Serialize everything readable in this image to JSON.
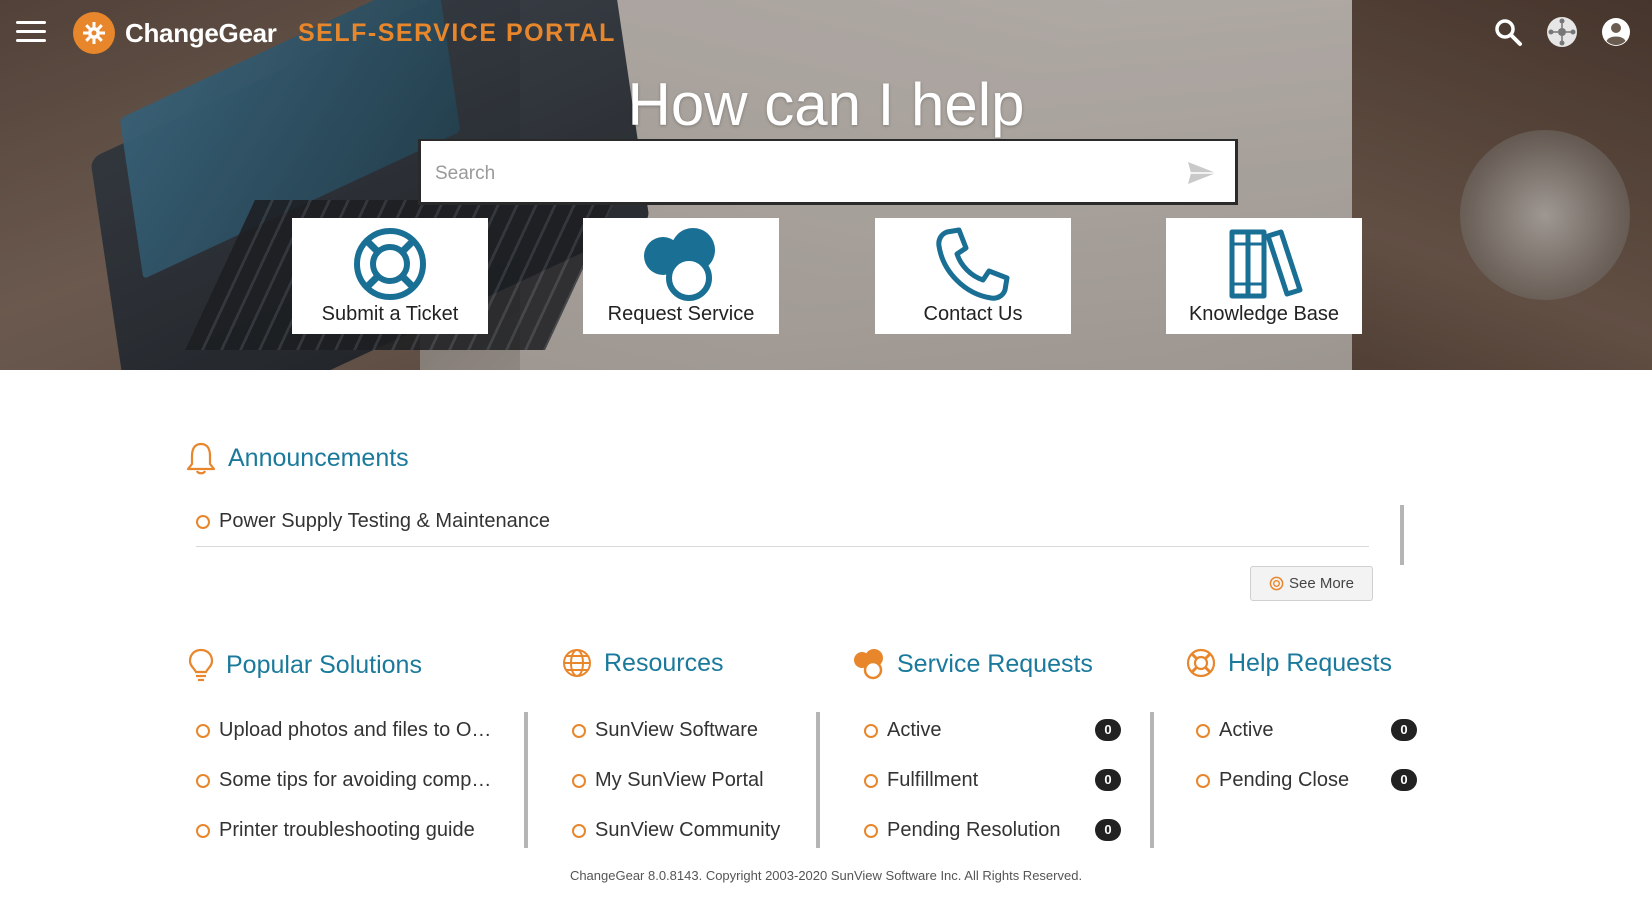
{
  "header": {
    "brand": "ChangeGear",
    "portal_title": "SELF-SERVICE PORTAL",
    "icons": [
      "menu-icon",
      "search-icon",
      "network-icon",
      "user-icon"
    ]
  },
  "hero": {
    "title": "How can I help",
    "search_placeholder": "Search",
    "tiles": [
      {
        "label": "Submit a Ticket",
        "icon": "lifebuoy-icon"
      },
      {
        "label": "Request Service",
        "icon": "service-bubbles-icon"
      },
      {
        "label": "Contact Us",
        "icon": "phone-icon"
      },
      {
        "label": "Knowledge Base",
        "icon": "books-icon"
      }
    ]
  },
  "announcements": {
    "title": "Announcements",
    "items": [
      "Power Supply Testing & Maintenance"
    ],
    "see_more": "See More"
  },
  "popular": {
    "title": "Popular Solutions",
    "items": [
      "Upload photos and files to O…",
      "Some tips for avoiding comp…",
      "Printer troubleshooting guide"
    ]
  },
  "resources": {
    "title": "Resources",
    "items": [
      "SunView Software",
      "My SunView Portal",
      "SunView Community"
    ]
  },
  "service_requests": {
    "title": "Service Requests",
    "items": [
      {
        "label": "Active",
        "count": "0"
      },
      {
        "label": "Fulfillment",
        "count": "0"
      },
      {
        "label": "Pending Resolution",
        "count": "0"
      }
    ]
  },
  "help_requests": {
    "title": "Help Requests",
    "items": [
      {
        "label": "Active",
        "count": "0"
      },
      {
        "label": "Pending Close",
        "count": "0"
      }
    ]
  },
  "footer": {
    "text": "ChangeGear 8.0.8143. Copyright 2003-2020 SunView Software Inc. All Rights Reserved."
  },
  "colors": {
    "accent_orange": "#e8862c",
    "heading_blue": "#1b7a9c",
    "icon_blue": "#1a6f95"
  }
}
